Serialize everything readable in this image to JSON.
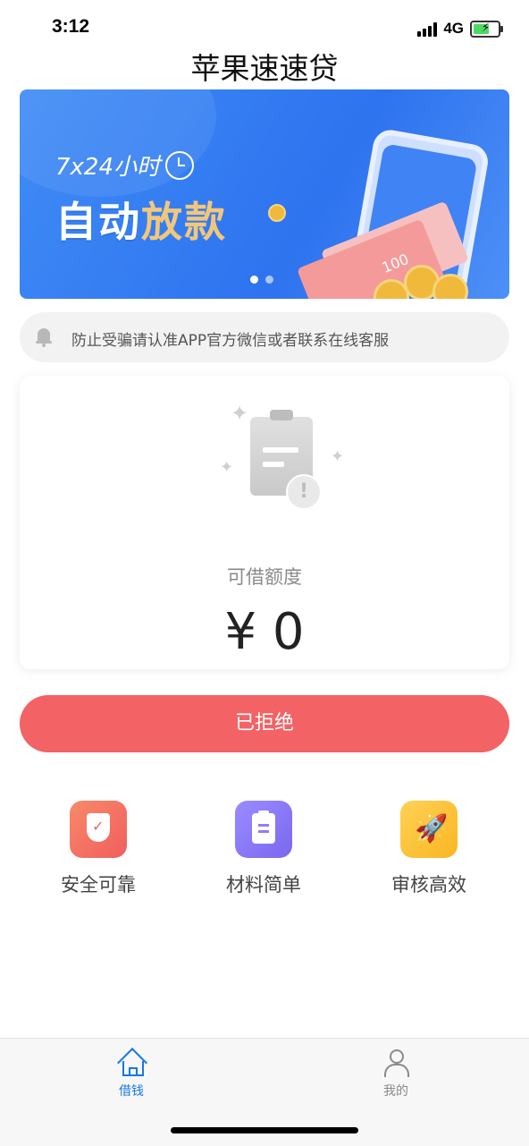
{
  "status_bar": {
    "time": "3:12",
    "network": "4G"
  },
  "header": {
    "title": "苹果速速贷"
  },
  "banner": {
    "tagline": "7x24小时",
    "headline_part1": "自动",
    "headline_part2": "放款",
    "bill_value": "100",
    "page_count": 2,
    "active_page": 1
  },
  "notice": {
    "text": "防止受骗请认准APP官方微信或者联系在线客服"
  },
  "credit_card": {
    "label": "可借额度",
    "amount": "¥ 0"
  },
  "action_button": {
    "label": "已拒绝"
  },
  "features": [
    {
      "label": "安全可靠",
      "icon": "shield-check-icon"
    },
    {
      "label": "材料简单",
      "icon": "clipboard-icon"
    },
    {
      "label": "审核高效",
      "icon": "rocket-icon"
    }
  ],
  "tab_bar": {
    "tabs": [
      {
        "label": "借钱",
        "icon": "home-icon",
        "active": true
      },
      {
        "label": "我的",
        "icon": "person-icon",
        "active": false
      }
    ]
  },
  "colors": {
    "primary_button": "#f36264",
    "active_tab": "#1677e6"
  }
}
